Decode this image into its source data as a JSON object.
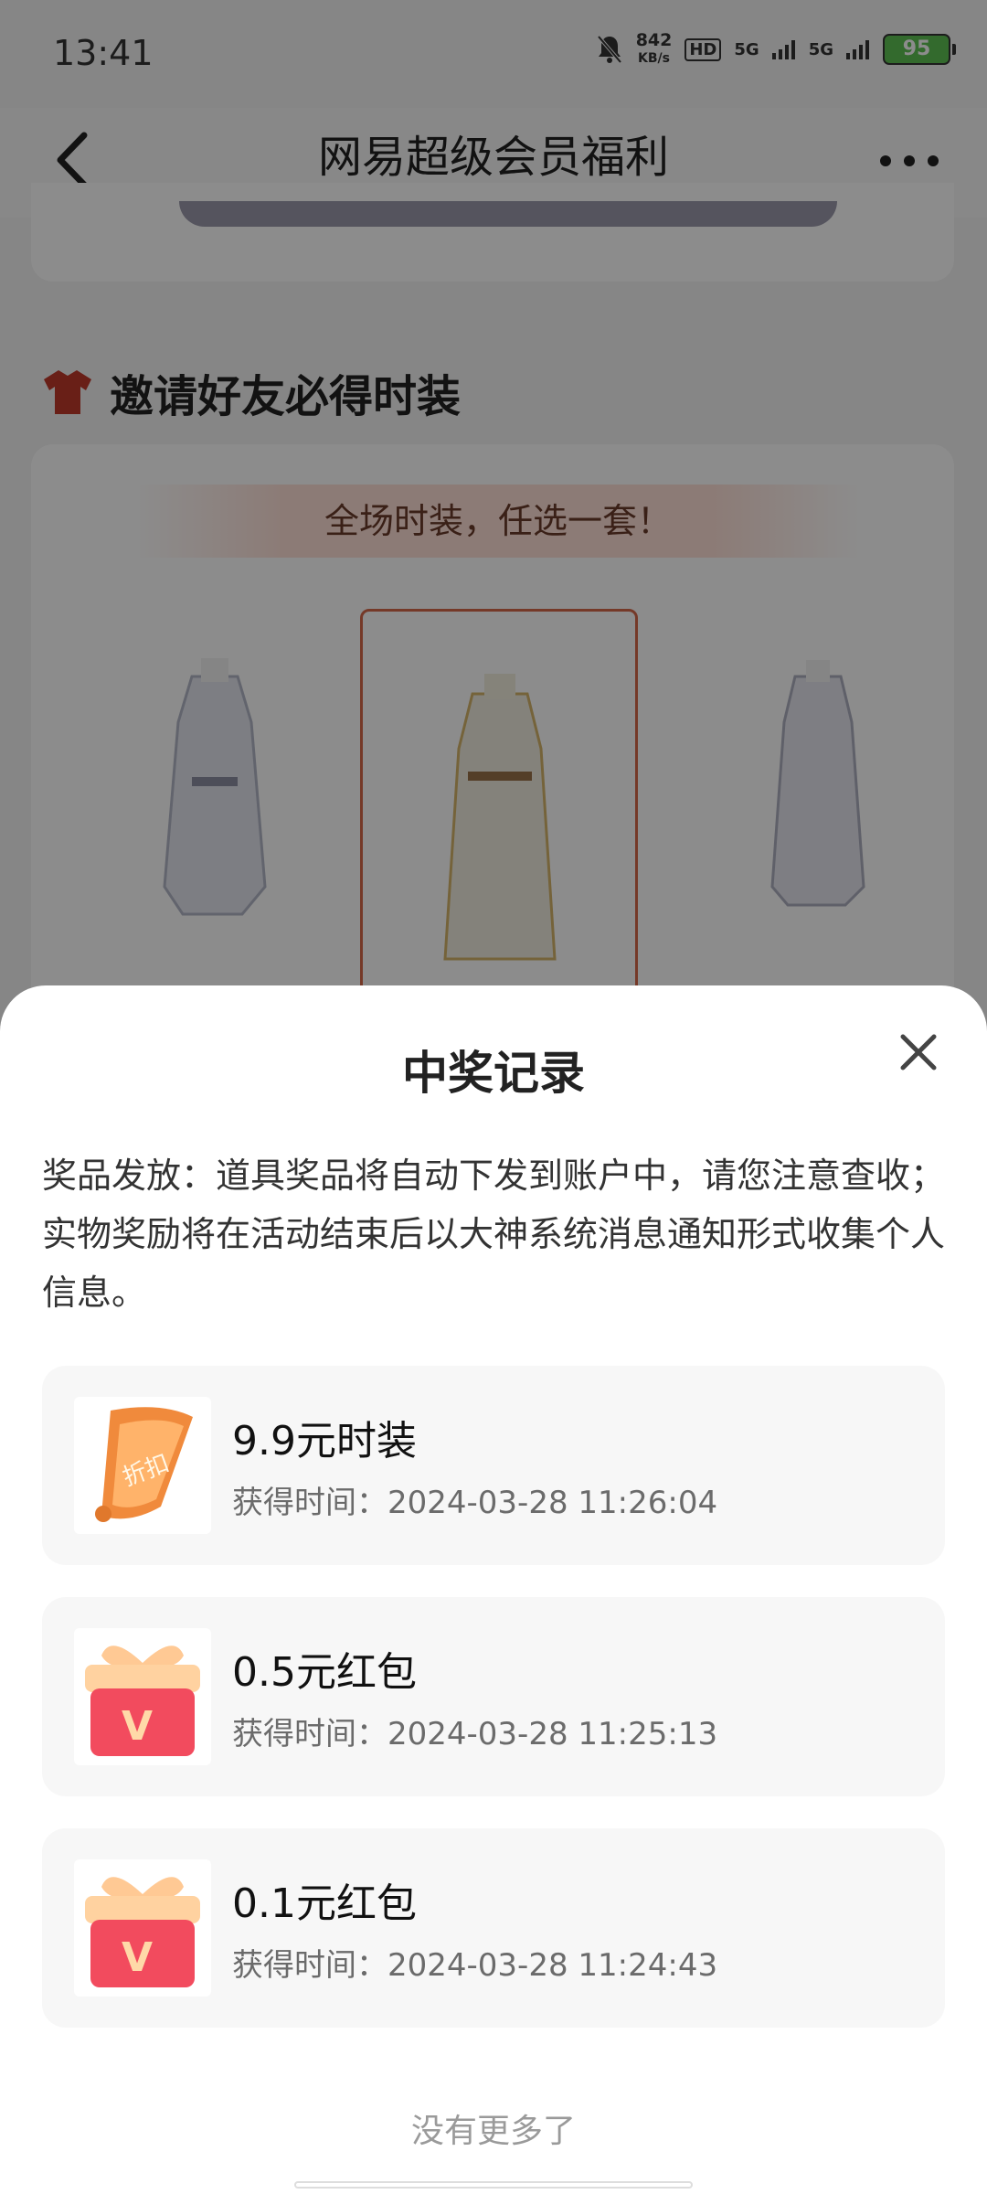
{
  "status_bar": {
    "time": "13:41",
    "net_speed": "842",
    "net_unit": "KB/s",
    "hd": "HD",
    "sig1": "5G",
    "sig2": "5G",
    "battery": "95"
  },
  "navbar": {
    "title": "网易超级会员福利",
    "back_icon": "chevron-left-icon",
    "more_icon": "more-dots-icon"
  },
  "section": {
    "title": "邀请好友必得时装",
    "icon": "shirt-icon"
  },
  "banner": {
    "text": "全场时装，任选一套！"
  },
  "sheet": {
    "title": "中奖记录",
    "close_icon": "close-icon",
    "notice": "奖品发放：道具奖品将自动下发到账户中，请您注意查收；实物奖励将在活动结束后以大神系统消息通知形式收集个人信息。",
    "records": [
      {
        "name": "9.9元时装",
        "time": "获得时间：2024-03-28 11:26:04",
        "icon": "discount-scroll-icon",
        "badge": "折扣"
      },
      {
        "name": "0.5元红包",
        "time": "获得时间：2024-03-28 11:25:13",
        "icon": "gift-box-icon",
        "badge": "V"
      },
      {
        "name": "0.1元红包",
        "time": "获得时间：2024-03-28 11:24:43",
        "icon": "gift-box-icon",
        "badge": "V"
      }
    ],
    "footer": "没有更多了"
  }
}
